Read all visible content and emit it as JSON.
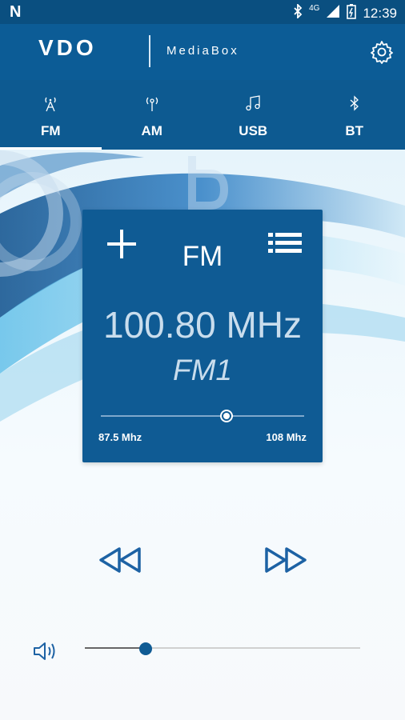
{
  "status": {
    "time": "12:39",
    "network": "4G",
    "left_icon": "N"
  },
  "app": {
    "brand": "VDO",
    "name": "MediaBox"
  },
  "tabs": [
    {
      "label": "FM",
      "icon": "antenna-icon"
    },
    {
      "label": "AM",
      "icon": "radio-icon"
    },
    {
      "label": "USB",
      "icon": "music-note-icon"
    },
    {
      "label": "BT",
      "icon": "bluetooth-icon"
    }
  ],
  "active_tab": 0,
  "tuner": {
    "band": "FM",
    "frequency": "100.80 MHz",
    "preset": "FM1",
    "min_label": "87.5 Mhz",
    "max_label": "108 Mhz",
    "position_fraction": 0.62
  },
  "volume": {
    "level_fraction": 0.22
  },
  "colors": {
    "primary": "#0c5c96",
    "card": "#0f5b94",
    "accent": "#1d62a4"
  }
}
